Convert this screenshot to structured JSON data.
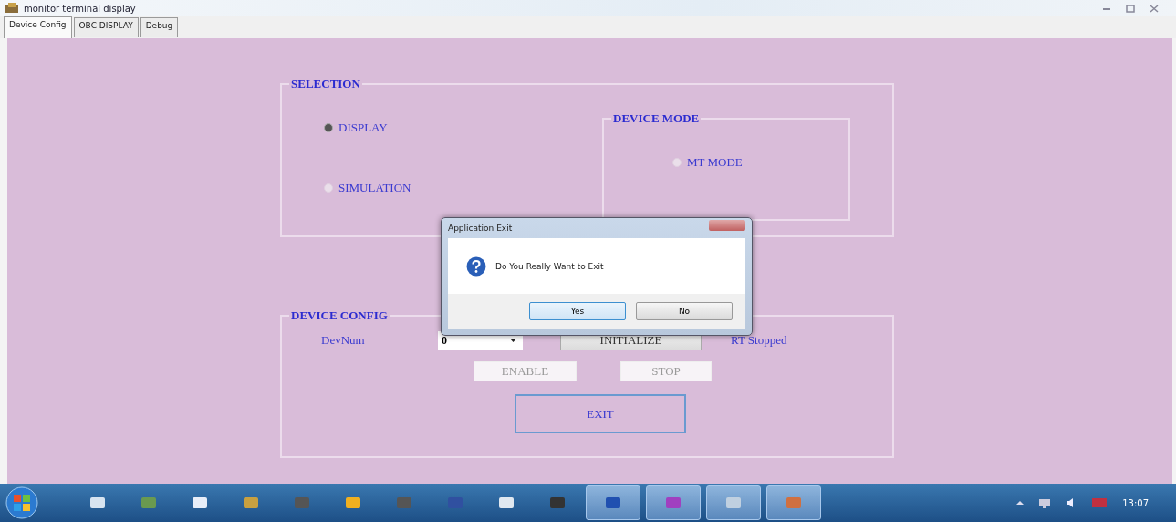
{
  "window": {
    "title": "monitor terminal display"
  },
  "tabs": [
    {
      "label": "Device Config",
      "selected": true
    },
    {
      "label": "OBC DISPLAY",
      "selected": false
    },
    {
      "label": "Debug",
      "selected": false
    }
  ],
  "selection": {
    "title": "SELECTION",
    "options": [
      {
        "label": "DISPLAY",
        "selected": true
      },
      {
        "label": "SIMULATION",
        "selected": false
      }
    ],
    "device_mode": {
      "title": "DEVICE MODE",
      "options": [
        {
          "label": "MT MODE",
          "selected": false
        }
      ]
    }
  },
  "device_config": {
    "title": "DEVICE CONFIG",
    "devnum_label": "DevNum",
    "devnum_value": "0",
    "status": "RT Stopped",
    "buttons": [
      {
        "label": "INITIALIZE",
        "kind": "initialize",
        "disabled": false,
        "focused": false
      },
      {
        "label": "ENABLE",
        "kind": "enable",
        "disabled": true,
        "focused": false
      },
      {
        "label": "STOP",
        "kind": "stop",
        "disabled": true,
        "focused": false
      },
      {
        "label": "EXIT",
        "kind": "exit",
        "disabled": false,
        "focused": true
      }
    ]
  },
  "dialog": {
    "title": "Application Exit",
    "message": "Do You Really Want to Exit",
    "buttons": [
      {
        "label": "Yes",
        "default": true
      },
      {
        "label": "No",
        "default": false
      }
    ]
  },
  "taskbar": {
    "clock": "13:07",
    "apps": [
      {
        "running": false
      },
      {
        "running": false
      },
      {
        "running": false
      },
      {
        "running": false
      },
      {
        "running": false
      },
      {
        "running": false
      },
      {
        "running": false
      },
      {
        "running": false
      },
      {
        "running": false
      },
      {
        "running": false
      },
      {
        "running": true
      },
      {
        "running": true
      },
      {
        "running": true
      },
      {
        "running": true
      }
    ]
  }
}
